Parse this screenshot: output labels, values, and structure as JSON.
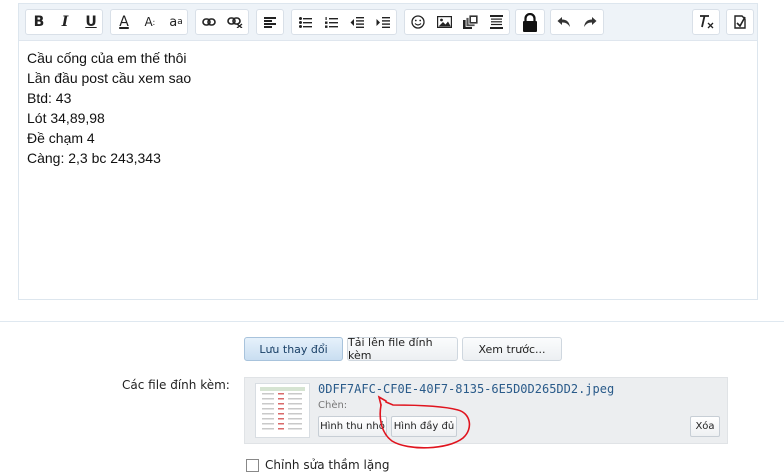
{
  "toolbar": {
    "icons": [
      "bold-icon",
      "italic-icon",
      "underline-icon",
      "text-color-icon",
      "font-size-icon",
      "font-family-icon",
      "link-icon",
      "unlink-icon",
      "align-icon",
      "bullet-list-icon",
      "numbered-list-icon",
      "outdent-icon",
      "indent-icon",
      "smilie-icon",
      "image-icon",
      "media-icon",
      "code-icon",
      "lock-icon",
      "undo-icon",
      "redo-icon",
      "remove-format-icon",
      "toggle-bbcode-icon"
    ],
    "bold": "B",
    "italic": "I",
    "underline": "U",
    "text_color": "A",
    "font_size": "A",
    "font_family": "a"
  },
  "editor": {
    "lines": [
      "Cầu cống của em thế thôi",
      "Lần đầu post cầu xem sao",
      "Btd: 43",
      "Lót 34,89,98",
      "Đề chạm 4",
      "Càng: 2,3 bc 243,343"
    ]
  },
  "actions": {
    "save": "Lưu thay đổi",
    "upload": "Tải lên file đính kèm",
    "preview": "Xem trước..."
  },
  "attachments": {
    "label": "Các file đính kèm:",
    "file_name": "0DFF7AFC-CF0E-40F7-8135-6E5D0D265DD2.jpeg",
    "insert_label": "Chèn:",
    "thumbnail_button": "Hình thu nhỏ",
    "full_image_button": "Hình đầy đủ",
    "delete_button": "Xóa",
    "annotation_color": "#e0141e"
  },
  "options": {
    "silent_edit": "Chỉnh sửa thầm lặng"
  }
}
